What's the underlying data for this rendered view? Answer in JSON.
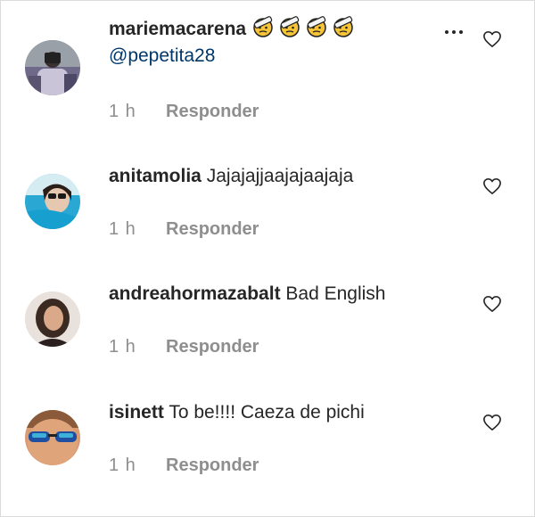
{
  "comments": [
    {
      "username": "mariemacarena",
      "emoji_icons": [
        "face-with-head-bandage-icon",
        "face-with-head-bandage-icon",
        "face-with-head-bandage-icon",
        "face-with-head-bandage-icon"
      ],
      "mention": "@pepetita28",
      "text": "",
      "time": "1 h",
      "reply_label": "Responder"
    },
    {
      "username": "anitamolia",
      "text": "Jajajajjaajajaajaja",
      "time": "1 h",
      "reply_label": "Responder"
    },
    {
      "username": "andreahormazabalt",
      "text": "Bad English",
      "time": "1 h",
      "reply_label": "Responder"
    },
    {
      "username": "isinett",
      "text": "To be!!!! Caeza de pichi",
      "time": "1 h",
      "reply_label": "Responder"
    }
  ],
  "icons": {
    "more": "more-options-icon",
    "like": "heart-outline-icon"
  },
  "colors": {
    "username": "#262626",
    "mention": "#00376b",
    "meta": "#8e8e8e",
    "border": "#dbdbdb"
  }
}
